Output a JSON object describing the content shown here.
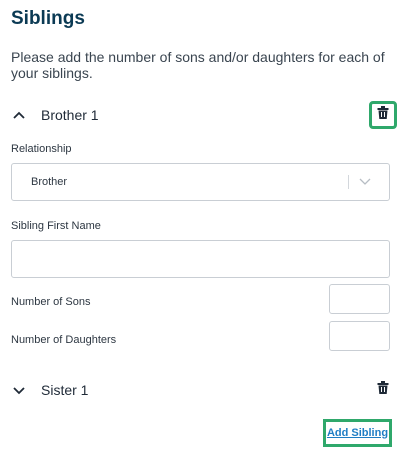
{
  "page": {
    "title": "Siblings",
    "intro": "Please add the number of sons and/or daughters for each of your siblings."
  },
  "siblings": [
    {
      "header": "Brother 1",
      "expanded": true,
      "relationship_label": "Relationship",
      "relationship_value": "Brother",
      "first_name_label": "Sibling First Name",
      "first_name_value": "",
      "sons_label": "Number of Sons",
      "sons_value": "",
      "daughters_label": "Number of Daughters",
      "daughters_value": ""
    },
    {
      "header": "Sister 1",
      "expanded": false
    }
  ],
  "actions": {
    "add_sibling": "Add Sibling"
  },
  "colors": {
    "title": "#0b3a54",
    "focus_highlight": "#2fa86b",
    "link": "#1e7dc4",
    "border": "#c9ced4"
  },
  "icons": [
    "chevron-up-icon",
    "chevron-down-icon",
    "trash-icon",
    "select-chevron-icon"
  ]
}
